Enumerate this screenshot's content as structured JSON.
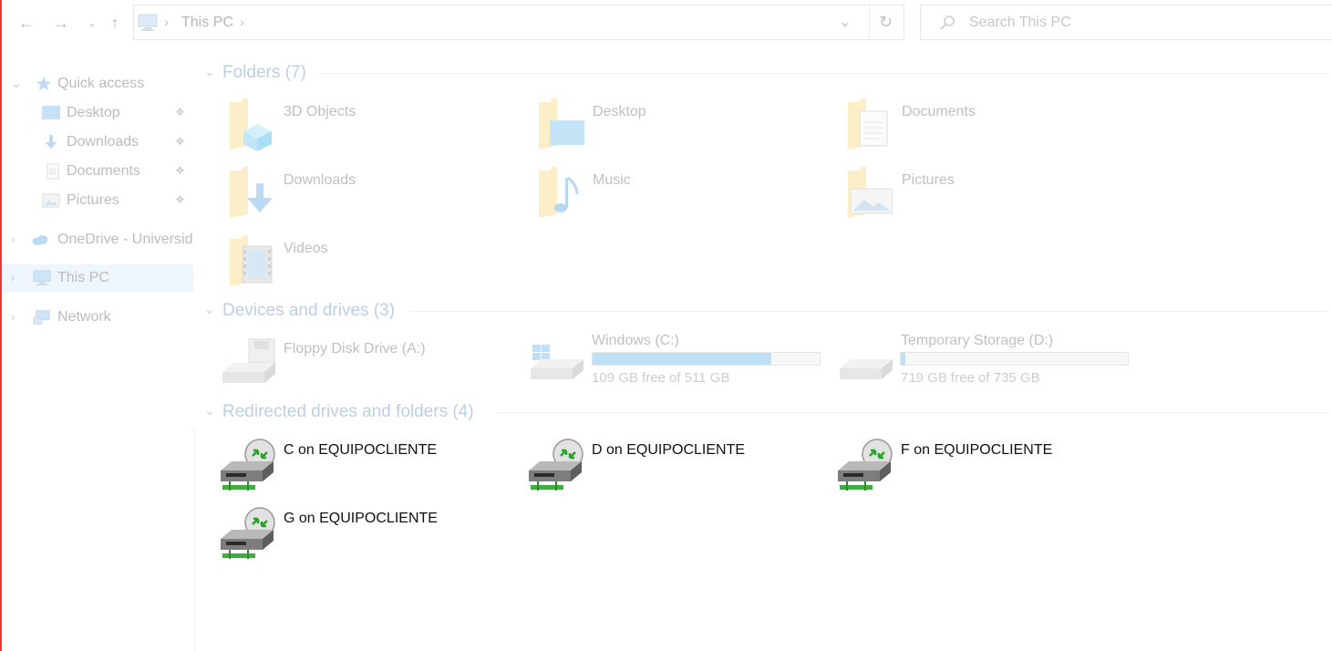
{
  "address_bar": {
    "path": [
      "This PC"
    ],
    "search_placeholder": "Search This PC"
  },
  "nav_pane": {
    "items": [
      {
        "label": "Quick access",
        "icon": "star-icon",
        "expandable": true,
        "expanded": true
      },
      {
        "label": "Desktop",
        "icon": "desktop-icon",
        "pinned": true
      },
      {
        "label": "Downloads",
        "icon": "download-icon",
        "pinned": true
      },
      {
        "label": "Documents",
        "icon": "document-icon",
        "pinned": true
      },
      {
        "label": "Pictures",
        "icon": "pictures-icon",
        "pinned": true
      },
      {
        "label": "OneDrive - Universid",
        "icon": "cloud-icon",
        "expandable": true
      },
      {
        "label": "This PC",
        "icon": "computer-icon",
        "expandable": true,
        "selected": true
      },
      {
        "label": "Network",
        "icon": "network-icon",
        "expandable": true
      }
    ]
  },
  "groups": {
    "folders": {
      "title": "Folders (7)",
      "items": [
        {
          "label": "3D Objects",
          "icon": "3d-objects-folder-icon"
        },
        {
          "label": "Desktop",
          "icon": "desktop-folder-icon"
        },
        {
          "label": "Documents",
          "icon": "documents-folder-icon"
        },
        {
          "label": "Downloads",
          "icon": "downloads-folder-icon"
        },
        {
          "label": "Music",
          "icon": "music-folder-icon"
        },
        {
          "label": "Pictures",
          "icon": "pictures-folder-icon"
        },
        {
          "label": "Videos",
          "icon": "videos-folder-icon"
        }
      ]
    },
    "devices": {
      "title": "Devices and drives (3)",
      "items": [
        {
          "label": "Floppy Disk Drive (A:)",
          "icon": "floppy-drive-icon"
        },
        {
          "label": "Windows (C:)",
          "icon": "windows-drive-icon",
          "free": "109 GB free of 511 GB",
          "used_fraction": 0.787
        },
        {
          "label": "Temporary Storage (D:)",
          "icon": "hard-drive-icon",
          "free": "719 GB free of 735 GB",
          "used_fraction": 0.022
        }
      ]
    },
    "redirected": {
      "title": "Redirected drives and folders (4)",
      "items": [
        {
          "label": "C on EQUIPOCLIENTE",
          "icon": "redirected-drive-icon"
        },
        {
          "label": "D on EQUIPOCLIENTE",
          "icon": "redirected-drive-icon"
        },
        {
          "label": "F on EQUIPOCLIENTE",
          "icon": "redirected-drive-icon"
        },
        {
          "label": "G on EQUIPOCLIENTE",
          "icon": "redirected-drive-icon"
        }
      ]
    }
  },
  "colors": {
    "accent": "#bccfe6",
    "drive_fill": "#bfe1f6",
    "selected_bg": "#eef5fc"
  }
}
